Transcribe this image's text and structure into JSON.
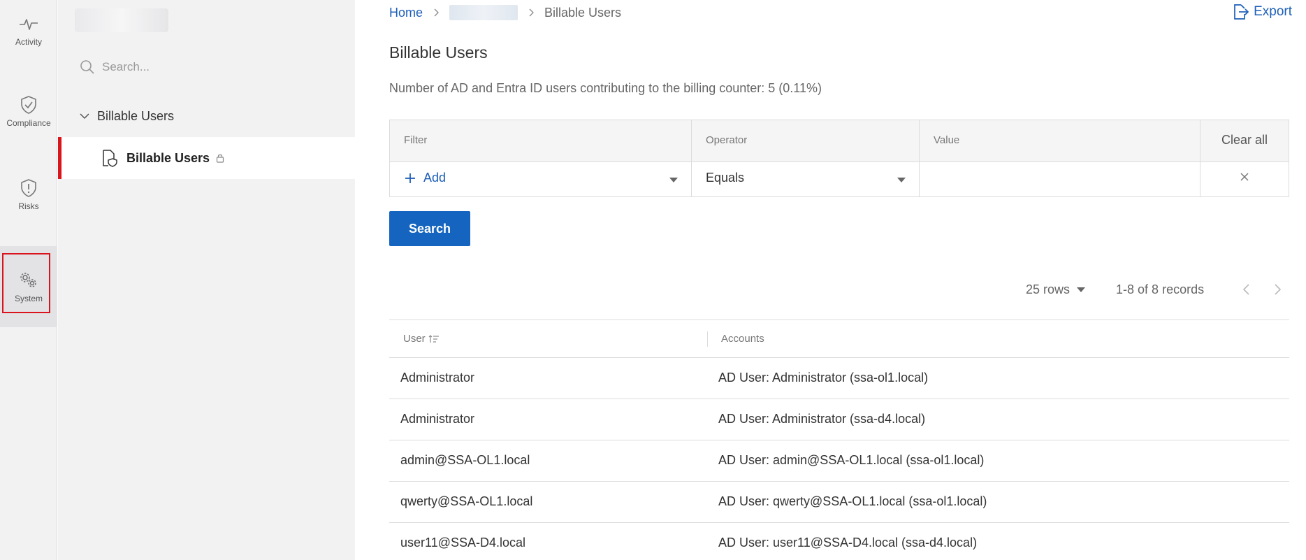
{
  "rail": {
    "items": [
      {
        "label": "Activity"
      },
      {
        "label": "Compliance"
      },
      {
        "label": "Risks"
      },
      {
        "label": "System"
      }
    ]
  },
  "nav": {
    "search_placeholder": "Search...",
    "group_label": "Billable Users",
    "sub_label": "Billable Users"
  },
  "breadcrumb": {
    "home": "Home",
    "current": "Billable Users"
  },
  "header": {
    "export_label": "Export",
    "title": "Billable Users",
    "subtitle": "Number of AD and Entra ID users contributing to the billing counter: 5 (0.11%)"
  },
  "filter": {
    "headers": [
      "Filter",
      "Operator",
      "Value"
    ],
    "clear_all": "Clear all",
    "add_label": "Add",
    "operator_value": "Equals",
    "value": ""
  },
  "search_button": "Search",
  "pager": {
    "rows": "25 rows",
    "records": "1-8 of 8 records"
  },
  "table": {
    "columns": [
      "User",
      "Accounts"
    ],
    "rows": [
      {
        "user": "Administrator",
        "accounts": "AD User: Administrator (ssa-ol1.local)"
      },
      {
        "user": "Administrator",
        "accounts": "AD User: Administrator (ssa-d4.local)"
      },
      {
        "user": "admin@SSA-OL1.local",
        "accounts": "AD User: admin@SSA-OL1.local (ssa-ol1.local)"
      },
      {
        "user": "qwerty@SSA-OL1.local",
        "accounts": "AD User: qwerty@SSA-OL1.local (ssa-ol1.local)"
      },
      {
        "user": "user11@SSA-D4.local",
        "accounts": "AD User: user11@SSA-D4.local (ssa-d4.local)"
      }
    ]
  },
  "colors": {
    "accent": "#1565c0",
    "link": "#1d5fb8",
    "highlight": "#d9141c"
  }
}
